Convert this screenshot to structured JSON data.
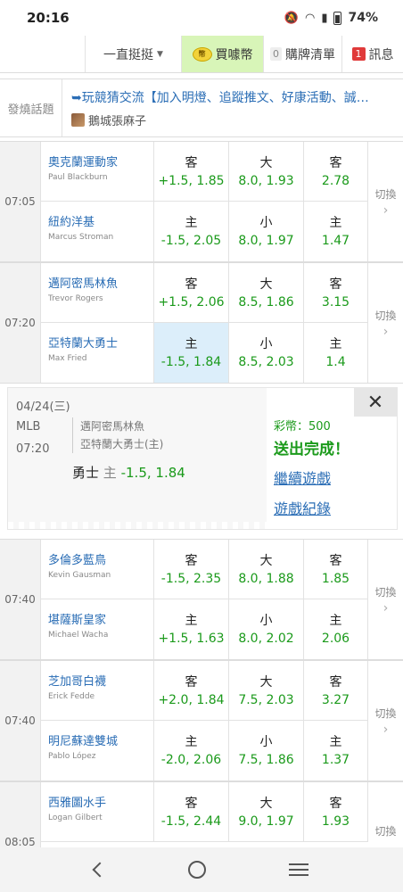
{
  "status": {
    "time": "20:16",
    "battery": "74%"
  },
  "topbar": {
    "filter_label": "一直挺挺",
    "buy_label": "買噱幣",
    "cart_count": "0",
    "cart_label": "購牌清單",
    "msg_count": "1",
    "msg_label": "訊息"
  },
  "hot": {
    "label": "發燒話題",
    "title": "➥玩競猜交流【加入明燈、追蹤推文、好康活動、誠…",
    "author": "鵝城張麻子"
  },
  "games": [
    {
      "time": "07:05",
      "away": {
        "name": "奧克蘭運動家",
        "pitcher": "Paul Blackburn"
      },
      "home": {
        "name": "紐約洋基",
        "pitcher": "Marcus Stroman"
      },
      "top": [
        {
          "side": "客",
          "val": "+1.5, 1.85"
        },
        {
          "side": "大",
          "val": "8.0, 1.93"
        },
        {
          "side": "客",
          "val": "2.78"
        }
      ],
      "bottom": [
        {
          "side": "主",
          "val": "-1.5, 2.05"
        },
        {
          "side": "小",
          "val": "8.0, 1.97"
        },
        {
          "side": "主",
          "val": "1.47"
        }
      ],
      "switch": "切換"
    },
    {
      "time": "07:20",
      "away": {
        "name": "邁阿密馬林魚",
        "pitcher": "Trevor Rogers"
      },
      "home": {
        "name": "亞特蘭大勇士",
        "pitcher": "Max Fried"
      },
      "top": [
        {
          "side": "客",
          "val": "+1.5, 2.06"
        },
        {
          "side": "大",
          "val": "8.5, 1.86"
        },
        {
          "side": "客",
          "val": "3.15"
        }
      ],
      "bottom": [
        {
          "side": "主",
          "val": "-1.5, 1.84"
        },
        {
          "side": "小",
          "val": "8.5, 2.03"
        },
        {
          "side": "主",
          "val": "1.4"
        }
      ],
      "switch": "切換"
    },
    {
      "time": "07:40",
      "away": {
        "name": "多倫多藍鳥",
        "pitcher": "Kevin Gausman"
      },
      "home": {
        "name": "堪薩斯皇家",
        "pitcher": "Michael Wacha"
      },
      "top": [
        {
          "side": "客",
          "val": "-1.5, 2.35"
        },
        {
          "side": "大",
          "val": "8.0, 1.88"
        },
        {
          "side": "客",
          "val": "1.85"
        }
      ],
      "bottom": [
        {
          "side": "主",
          "val": "+1.5, 1.63"
        },
        {
          "side": "小",
          "val": "8.0, 2.02"
        },
        {
          "side": "主",
          "val": "2.06"
        }
      ],
      "switch": "切換"
    },
    {
      "time": "07:40",
      "away": {
        "name": "芝加哥白襪",
        "pitcher": "Erick Fedde"
      },
      "home": {
        "name": "明尼蘇達雙城",
        "pitcher": "Pablo López"
      },
      "top": [
        {
          "side": "客",
          "val": "+2.0, 1.84"
        },
        {
          "side": "大",
          "val": "7.5, 2.03"
        },
        {
          "side": "客",
          "val": "3.27"
        }
      ],
      "bottom": [
        {
          "side": "主",
          "val": "-2.0, 2.06"
        },
        {
          "side": "小",
          "val": "7.5, 1.86"
        },
        {
          "side": "主",
          "val": "1.37"
        }
      ],
      "switch": "切換"
    },
    {
      "time": "08:05",
      "away": {
        "name": "西雅圖水手",
        "pitcher": "Logan Gilbert"
      },
      "home": {
        "name": "",
        "pitcher": ""
      },
      "top": [
        {
          "side": "客",
          "val": "-1.5, 2.44"
        },
        {
          "side": "大",
          "val": "9.0, 1.97"
        },
        {
          "side": "客",
          "val": "1.93"
        }
      ],
      "bottom": [
        {
          "side": "",
          "val": ""
        },
        {
          "side": "",
          "val": ""
        },
        {
          "side": "",
          "val": ""
        }
      ],
      "switch": "切換"
    }
  ],
  "popup": {
    "date": "04/24(三)",
    "league": "MLB",
    "time": "07:20",
    "away": "邁阿密馬林魚",
    "home": "亞特蘭大勇士(主)",
    "bet_team": "勇士",
    "bet_side": "主",
    "bet_val": "-1.5, 1.84",
    "coin": "彩幣：500",
    "done": "送出完成！",
    "continue": "繼續遊戲",
    "record": "遊戲紀錄"
  }
}
